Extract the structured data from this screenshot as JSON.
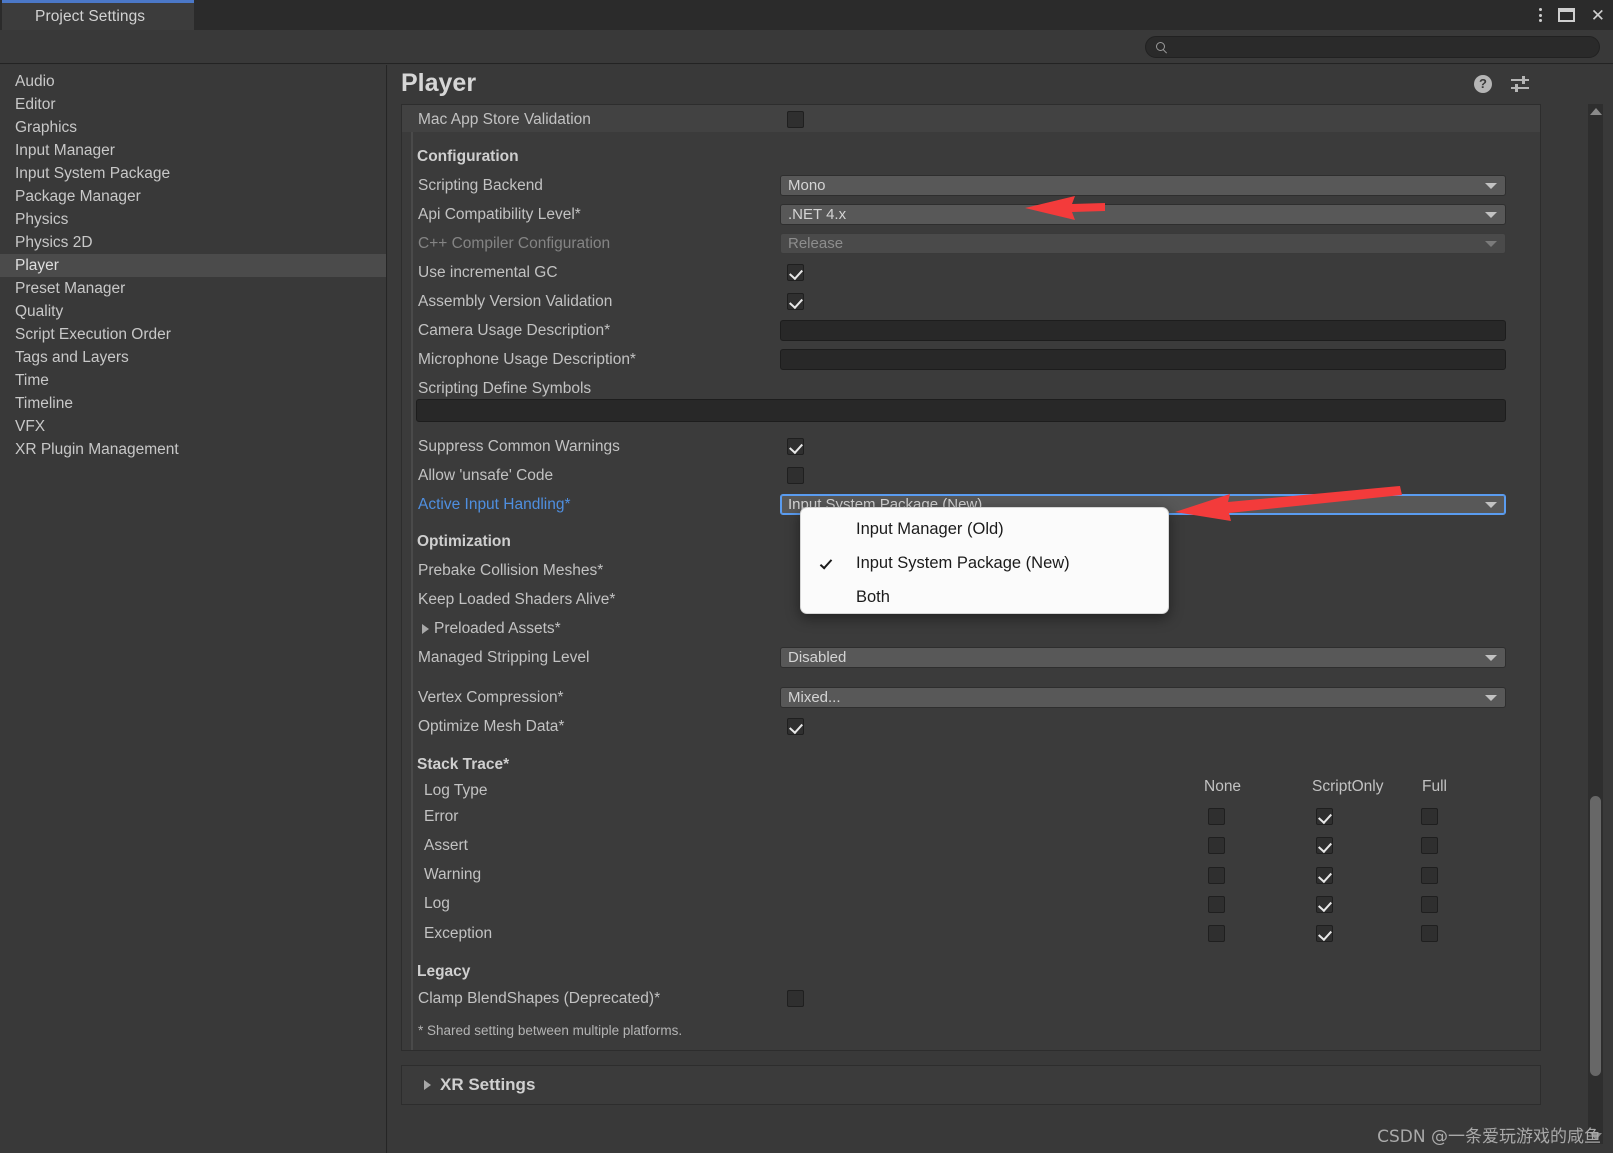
{
  "window": {
    "tab_title": "Project Settings",
    "tab_icon": "gear-icon",
    "controls": {
      "menu": "⋮",
      "maximize": "maximize-icon",
      "close": "✕"
    }
  },
  "search": {
    "value": "",
    "placeholder": "",
    "icon": "search-icon"
  },
  "sidebar": {
    "items": [
      {
        "label": "Audio",
        "selected": false
      },
      {
        "label": "Editor",
        "selected": false
      },
      {
        "label": "Graphics",
        "selected": false
      },
      {
        "label": "Input Manager",
        "selected": false
      },
      {
        "label": "Input System Package",
        "selected": false
      },
      {
        "label": "Package Manager",
        "selected": false
      },
      {
        "label": "Physics",
        "selected": false
      },
      {
        "label": "Physics 2D",
        "selected": false
      },
      {
        "label": "Player",
        "selected": true
      },
      {
        "label": "Preset Manager",
        "selected": false
      },
      {
        "label": "Quality",
        "selected": false
      },
      {
        "label": "Script Execution Order",
        "selected": false
      },
      {
        "label": "Tags and Layers",
        "selected": false
      },
      {
        "label": "Time",
        "selected": false
      },
      {
        "label": "Timeline",
        "selected": false
      },
      {
        "label": "VFX",
        "selected": false
      },
      {
        "label": "XR Plugin Management",
        "selected": false
      }
    ]
  },
  "panel": {
    "title": "Player",
    "header_icons": [
      "help-icon",
      "preset-icon",
      "settings-gear-icon"
    ]
  },
  "settings": {
    "mac_app_store_validation": {
      "label": "Mac App Store Validation",
      "checked": false
    },
    "configuration_header": "Configuration",
    "scripting_backend": {
      "label": "Scripting Backend",
      "value": "Mono"
    },
    "api_compatibility_level": {
      "label": "Api Compatibility Level*",
      "value": ".NET 4.x"
    },
    "cpp_compiler_configuration": {
      "label": "C++ Compiler Configuration",
      "value": "Release",
      "disabled": true
    },
    "use_incremental_gc": {
      "label": "Use incremental GC",
      "checked": true
    },
    "assembly_version_validation": {
      "label": "Assembly Version Validation",
      "checked": true
    },
    "camera_usage_description": {
      "label": "Camera Usage Description*",
      "value": ""
    },
    "microphone_usage_description": {
      "label": "Microphone Usage Description*",
      "value": ""
    },
    "scripting_define_symbols": {
      "label": "Scripting Define Symbols",
      "value": ""
    },
    "suppress_common_warnings": {
      "label": "Suppress Common Warnings",
      "checked": true
    },
    "allow_unsafe_code": {
      "label": "Allow 'unsafe' Code",
      "checked": false
    },
    "active_input_handling": {
      "label": "Active Input Handling*",
      "value": "Input System Package (New)",
      "options": [
        "Input Manager (Old)",
        "Input System Package (New)",
        "Both"
      ],
      "selected_option": "Input System Package (New)",
      "open": true
    },
    "optimization_header": "Optimization",
    "prebake_collision_meshes": {
      "label": "Prebake Collision Meshes*"
    },
    "keep_loaded_shaders_alive": {
      "label": "Keep Loaded Shaders Alive*"
    },
    "preloaded_assets": {
      "label": "Preloaded Assets*",
      "expanded": false
    },
    "managed_stripping_level": {
      "label": "Managed Stripping Level",
      "value": "Disabled"
    },
    "vertex_compression": {
      "label": "Vertex Compression*",
      "value": "Mixed..."
    },
    "optimize_mesh_data": {
      "label": "Optimize Mesh Data*",
      "checked": true
    },
    "stack_trace_header": "Stack Trace*",
    "stack_trace": {
      "row_label": "Log Type",
      "columns": [
        "None",
        "ScriptOnly",
        "Full"
      ],
      "rows": [
        {
          "label": "Error",
          "None": false,
          "ScriptOnly": true,
          "Full": false
        },
        {
          "label": "Assert",
          "None": false,
          "ScriptOnly": true,
          "Full": false
        },
        {
          "label": "Warning",
          "None": false,
          "ScriptOnly": true,
          "Full": false
        },
        {
          "label": "Log",
          "None": false,
          "ScriptOnly": true,
          "Full": false
        },
        {
          "label": "Exception",
          "None": false,
          "ScriptOnly": true,
          "Full": false
        }
      ]
    },
    "legacy_header": "Legacy",
    "clamp_blendshapes": {
      "label": "Clamp BlendShapes (Deprecated)*",
      "checked": false
    },
    "footnote": "* Shared setting between multiple platforms.",
    "xr_settings": {
      "label": "XR Settings",
      "expanded": false
    }
  },
  "watermark": "CSDN @一条爱玩游戏的咸鱼",
  "colors": {
    "accent_blue": "#4b78c8",
    "focus_blue": "#5a9cf0",
    "link_blue": "#4f8fe0",
    "arrow_red": "#f33b3b",
    "panel_bg": "#393939",
    "field_bg": "#585858"
  }
}
